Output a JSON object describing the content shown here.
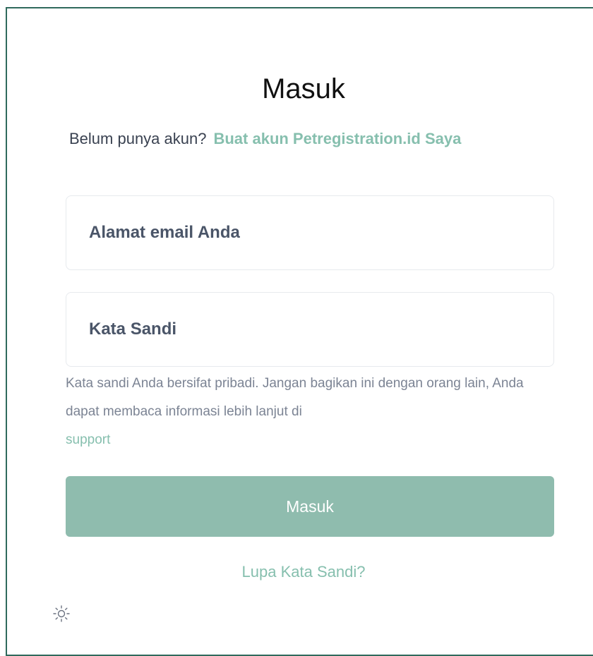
{
  "login": {
    "title": "Masuk",
    "signup_prompt": "Belum punya akun?",
    "signup_link": "Buat akun Petregistration.id Saya",
    "email_placeholder": "Alamat email Anda",
    "password_placeholder": "Kata Sandi",
    "helper_text": "Kata sandi Anda bersifat pribadi. Jangan bagikan ini dengan orang lain, Anda dapat membaca informasi lebih lanjut di",
    "support_link": "support",
    "submit_label": "Masuk",
    "forgot_link": "Lupa Kata Sandi?"
  },
  "footer": {
    "theme_icon": "sun-icon"
  },
  "colors": {
    "accent": "#86bfae",
    "button": "#8fbcae",
    "frame_border": "#2f6a5c"
  }
}
